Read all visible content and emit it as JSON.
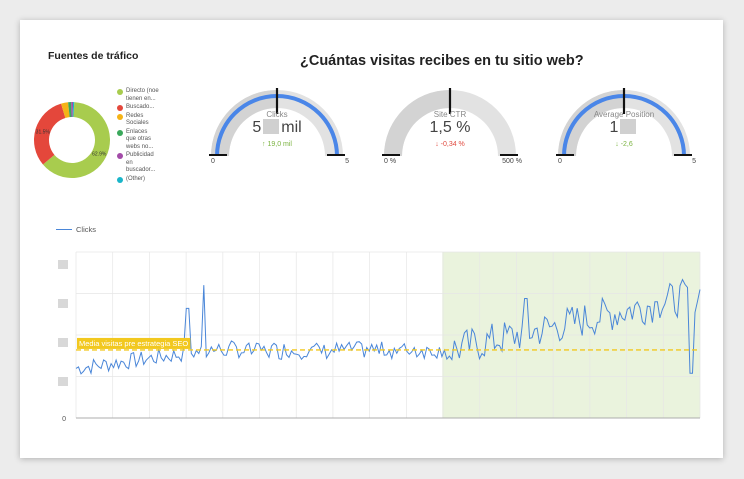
{
  "traffic": {
    "title": "Fuentes de tráfico",
    "slices": [
      {
        "label": "Directo (noe tienen en...",
        "value": 62.9,
        "color": "#a8cc4e",
        "pct_label": "62.9%"
      },
      {
        "label": "Buscado...",
        "value": 31.5,
        "color": "#e4473b",
        "pct_label": "31.5%"
      },
      {
        "label": "Redes Sociales",
        "value": 3.0,
        "color": "#f5b316",
        "pct_label": ""
      },
      {
        "label": "Enlaces que otras webs no...",
        "value": 1.3,
        "color": "#3aa85b",
        "pct_label": ""
      },
      {
        "label": "Publicidad en buscador...",
        "value": 0.8,
        "color": "#a34ba8",
        "pct_label": ""
      },
      {
        "label": "(Other)",
        "value": 0.5,
        "color": "#1ab5c9",
        "pct_label": ""
      }
    ]
  },
  "main_title": "¿Cuántas visitas recibes en tu sitio web?",
  "gauges": [
    {
      "label": "Clicks",
      "value_prefix": "5",
      "value_suffix": "mil",
      "delta": "19,0 mil",
      "delta_dir": "up",
      "delta_color": "#7cb342",
      "min": "0",
      "max": "5",
      "fill": 1.0,
      "target": 0.5,
      "color": "#4a86e8"
    },
    {
      "label": "Site CTR",
      "value_prefix": "1,5 %",
      "value_suffix": "",
      "delta": "-0,34 %",
      "delta_dir": "down",
      "delta_color": "#e04a3f",
      "min": "0 %",
      "max": "500 %",
      "fill": 0.003,
      "target": 0.5,
      "color": "#4a86e8"
    },
    {
      "label": "Average Position",
      "value_prefix": "1",
      "value_suffix": "",
      "delta": "-2,6",
      "delta_dir": "down",
      "delta_color": "#7cb342",
      "min": "0",
      "max": "5",
      "fill": 1.0,
      "target": 0.5,
      "color": "#4a86e8"
    }
  ],
  "chart_data": {
    "type": "line",
    "series": [
      {
        "name": "Clicks",
        "color": "#4a86d8"
      }
    ],
    "y_tick_zero": "0",
    "reference_line": {
      "label": "Media visitas pre estrategia SEO",
      "color": "#f2c81f"
    },
    "highlight_color": "#eaf3dd",
    "grid": true
  },
  "colors": {
    "accent": "#4a86e8",
    "card": "#ffffff",
    "background": "#ececec"
  }
}
